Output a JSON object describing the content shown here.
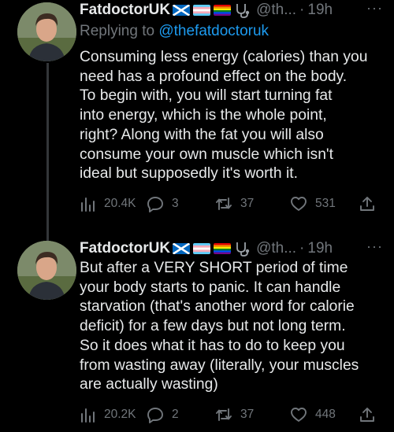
{
  "tweets": [
    {
      "display_name": "FatdoctorUK",
      "handle": "@th...",
      "separator": "·",
      "time": "19h",
      "more": "···",
      "replying_prefix": "Replying to",
      "replying_to": "@thefatdoctoruk",
      "lines": [
        "Consuming less energy (calories) than you",
        "need has a profound effect on the body.",
        "To begin with, you will start turning fat",
        "into energy, which is the whole point,",
        "right? Along with the fat you will also",
        "consume your own muscle which isn't",
        "ideal but supposedly it's worth it."
      ],
      "views": "20.4K",
      "replies": "3",
      "retweets": "37",
      "likes": "531"
    },
    {
      "display_name": "FatdoctorUK",
      "handle": "@th...",
      "separator": "·",
      "time": "19h",
      "more": "···",
      "lines": [
        "But after a VERY SHORT period of time",
        "your body starts to panic. It can handle",
        "starvation (that's another word for calorie",
        "deficit) for a few days but not long term.",
        "So it does what it has to do to keep you",
        "from wasting away (literally, your muscles",
        "are actually wasting)"
      ],
      "views": "20.2K",
      "replies": "2",
      "retweets": "37",
      "likes": "448"
    }
  ],
  "icons": {
    "flags": [
      "scotland-flag-icon",
      "transgender-flag-icon",
      "rainbow-flag-icon"
    ],
    "badge": "stethoscope-icon",
    "actions": [
      "views-icon",
      "reply-icon",
      "retweet-icon",
      "like-icon",
      "share-icon"
    ]
  },
  "colors": {
    "background": "#000000",
    "text": "#e7e9ea",
    "muted": "#71767b",
    "link": "#1d9bf0",
    "thread_line": "#333639"
  }
}
